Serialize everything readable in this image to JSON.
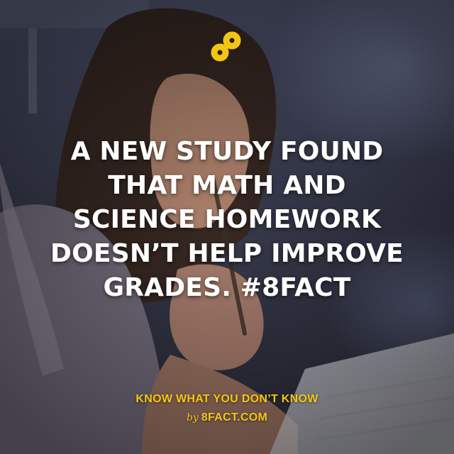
{
  "brand": {
    "logo_icon": "infinity-eight-icon",
    "accent_color": "#f3c614"
  },
  "headline": {
    "lines": [
      "A NEW STUDY FOUND",
      "THAT MATH AND",
      "SCIENCE HOMEWORK",
      "DOESN’T HELP IMPROVE",
      "GRADES. #8FACT"
    ]
  },
  "footer": {
    "tagline": "KNOW WHAT YOU DON’T KNOW",
    "by": "by",
    "site": "8FACT.COM"
  }
}
